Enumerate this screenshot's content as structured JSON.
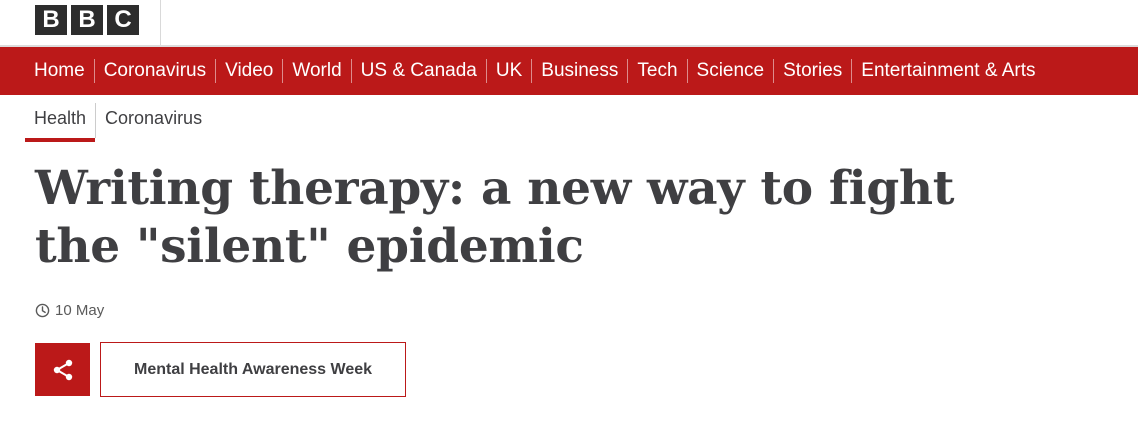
{
  "masthead": {
    "logo_letters": [
      "B",
      "B",
      "C"
    ]
  },
  "nav": {
    "items": [
      "Home",
      "Coronavirus",
      "Video",
      "World",
      "US & Canada",
      "UK",
      "Business",
      "Tech",
      "Science",
      "Stories",
      "Entertainment & Arts"
    ]
  },
  "subnav": {
    "items": [
      "Health",
      "Coronavirus"
    ],
    "active": "Health"
  },
  "article": {
    "headline": "Writing therapy: a new way to fight the \"silent\" epidemic",
    "date": "10 May",
    "tag": "Mental Health Awareness Week"
  },
  "icons": {
    "clock": "clock-icon",
    "share": "share-icon"
  },
  "colors": {
    "brand_red": "#bb1919",
    "logo_block": "#2d2d2d",
    "text": "#3f3f42"
  }
}
